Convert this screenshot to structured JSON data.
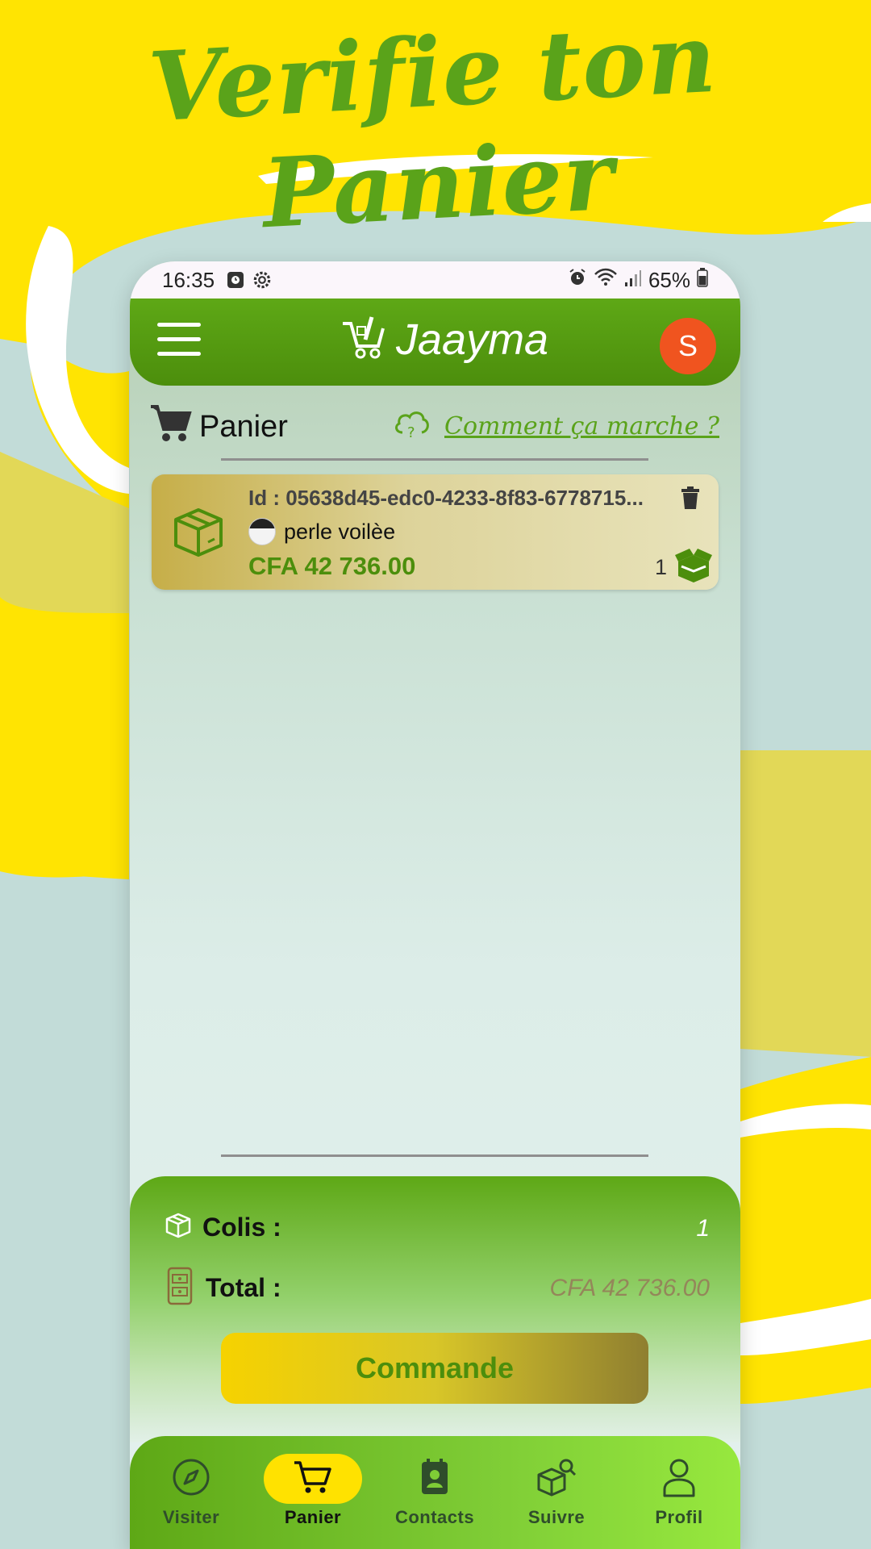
{
  "promo": {
    "headline": "Verifie ton Panier"
  },
  "status_bar": {
    "time": "16:35",
    "battery": "65%"
  },
  "app_bar": {
    "brand": "Jaayma",
    "avatar_initial": "S"
  },
  "section": {
    "title": "Panier",
    "help_link": "Comment ça marche ?"
  },
  "cart_items": [
    {
      "id": "Id : 05638d45-edc0-4233-8f83-6778715...",
      "shop": "perle voilèe",
      "price": "CFA 42 736.00",
      "quantity": "1"
    }
  ],
  "summary": {
    "colis_label": "Colis :",
    "colis_value": "1",
    "total_label": "Total :",
    "total_value": "CFA 42 736.00",
    "order_button": "Commande"
  },
  "bottom_nav": [
    {
      "label": "Visiter",
      "icon": "compass-icon"
    },
    {
      "label": "Panier",
      "icon": "cart-icon",
      "active": true
    },
    {
      "label": "Contacts",
      "icon": "contact-book-icon"
    },
    {
      "label": "Suivre",
      "icon": "package-search-icon"
    },
    {
      "label": "Profil",
      "icon": "person-icon"
    }
  ],
  "colors": {
    "brand_green": "#5ea816",
    "accent_yellow": "#ffe200",
    "avatar_orange": "#f0541f",
    "background": "#c2dcd8"
  }
}
